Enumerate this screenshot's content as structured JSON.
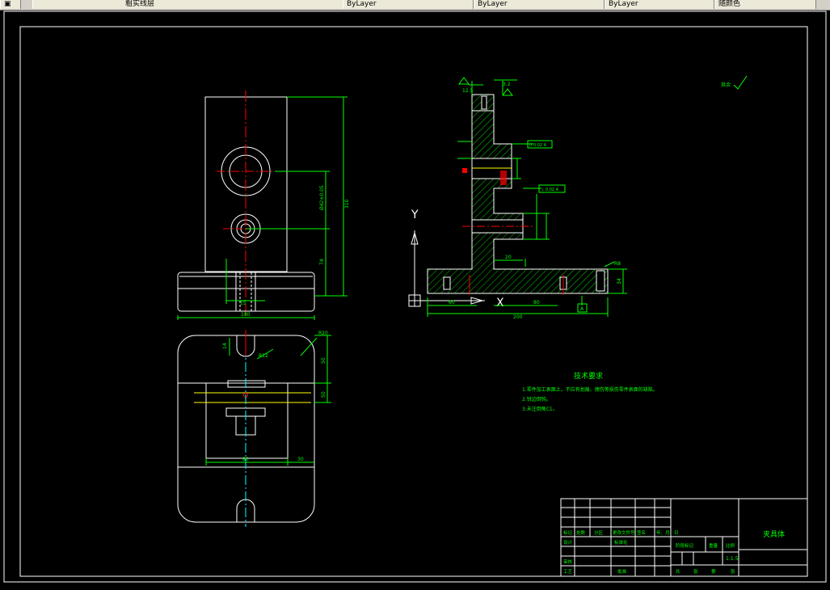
{
  "toolbar": {
    "layer_text": "粗实线层",
    "field_1": "ByLayer",
    "field_2": "ByLayer",
    "field_3": "ByLayer",
    "field_4": "随颜色"
  },
  "colors": {
    "background": "#000000",
    "geometry": "#ffffff",
    "dimension": "#00ff00",
    "centerline": "#ff0000",
    "hatch": "#00ff00",
    "yellow": "#ffff00"
  },
  "front_view": {
    "dim_width": "180",
    "dim_height": "310",
    "dim_hole": "Ø42±0.05",
    "dim_base": "74",
    "dim_small": "15"
  },
  "top_view": {
    "dim_r": "R20",
    "dim_r2": "R12",
    "dim_50a": "50",
    "dim_50b": "50",
    "dim_80": "80",
    "dim_30": "30",
    "dim_14": "14"
  },
  "section_view": {
    "roughness_top": "12.5",
    "roughness_top2": "3.2",
    "tol_1": "// 0.02 A",
    "tol_2": "⊥ 0.02 A",
    "dim_200": "200",
    "dim_60": "60",
    "dim_80": "80",
    "dim_34": "34",
    "dim_20": "20",
    "dim_r8": "R8",
    "datum": "A",
    "axis_y": "Y",
    "axis_x": "X",
    "other": "其余"
  },
  "tech_req": {
    "title": "技术要求",
    "items": [
      "1.零件加工表面上，不应有划痕、擦伤等损伤零件表面的缺陷。",
      "2.锐边倒钝。",
      "3.未注倒角C1。"
    ]
  },
  "title_block": {
    "part_name": "夹具体",
    "scale": "1:1.5",
    "h_mark": "标记",
    "h_count": "处数",
    "h_zone": "分区",
    "h_doc": "更改文件号",
    "h_sign": "签名",
    "h_date": "年、月、日",
    "design": "设计",
    "standard": "标准化",
    "check": "审核",
    "process": "工艺",
    "approve": "批准",
    "stage_mark": "阶段标记",
    "weight": "重量",
    "ratio": "比例",
    "sheet_total": "共",
    "sheet_unit": "张",
    "sheet_no": "第",
    "sheet_unit2": "张"
  }
}
